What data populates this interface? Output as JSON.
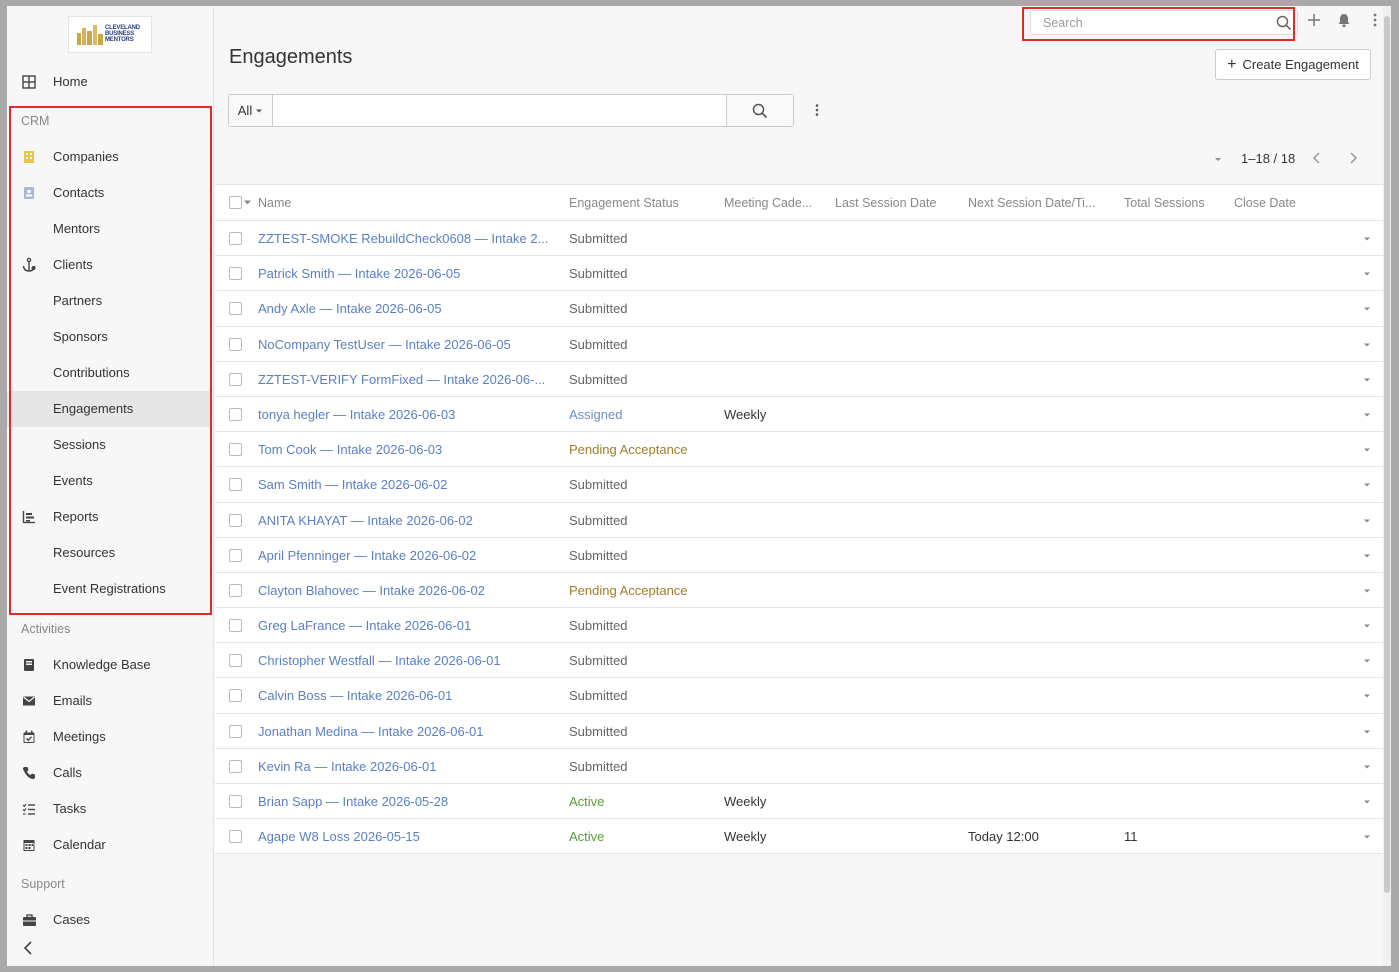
{
  "sidebar": {
    "logo_text": "CLEVELAND BUSINESS MENTORS",
    "home": "Home",
    "crm_label": "CRM",
    "crm_items": [
      {
        "label": "Companies",
        "icon": "building-icon"
      },
      {
        "label": "Contacts",
        "icon": "contact-card-icon"
      },
      {
        "label": "Mentors",
        "icon": ""
      },
      {
        "label": "Clients",
        "icon": "anchor-icon"
      },
      {
        "label": "Partners",
        "icon": ""
      },
      {
        "label": "Sponsors",
        "icon": ""
      },
      {
        "label": "Contributions",
        "icon": ""
      },
      {
        "label": "Engagements",
        "icon": "",
        "active": true
      },
      {
        "label": "Sessions",
        "icon": ""
      },
      {
        "label": "Events",
        "icon": ""
      },
      {
        "label": "Reports",
        "icon": "bar-chart-icon"
      },
      {
        "label": "Resources",
        "icon": ""
      },
      {
        "label": "Event Registrations",
        "icon": ""
      }
    ],
    "activities_label": "Activities",
    "activity_items": [
      {
        "label": "Knowledge Base",
        "icon": "book-icon"
      },
      {
        "label": "Emails",
        "icon": "envelope-icon"
      },
      {
        "label": "Meetings",
        "icon": "calendar-check-icon"
      },
      {
        "label": "Calls",
        "icon": "phone-icon"
      },
      {
        "label": "Tasks",
        "icon": "task-list-icon"
      },
      {
        "label": "Calendar",
        "icon": "calendar-icon"
      }
    ],
    "support_label": "Support",
    "support_items": [
      {
        "label": "Cases",
        "icon": "briefcase-icon"
      }
    ]
  },
  "header": {
    "title": "Engagements",
    "search_placeholder": "Search",
    "create_label": "Create Engagement"
  },
  "filter": {
    "scope": "All"
  },
  "pager": {
    "text": "1–18 / 18"
  },
  "table": {
    "columns": [
      "Name",
      "Engagement Status",
      "Meeting Cade...",
      "Last Session Date",
      "Next Session Date/Ti...",
      "Total Sessions",
      "Close Date"
    ],
    "rows": [
      {
        "name": "ZZTEST-SMOKE RebuildCheck0608 — Intake 2...",
        "status": "Submitted",
        "cadence": "",
        "next": "",
        "total": ""
      },
      {
        "name": "Patrick Smith — Intake 2026-06-05",
        "status": "Submitted",
        "cadence": "",
        "next": "",
        "total": ""
      },
      {
        "name": "Andy Axle — Intake 2026-06-05",
        "status": "Submitted",
        "cadence": "",
        "next": "",
        "total": ""
      },
      {
        "name": "NoCompany TestUser — Intake 2026-06-05",
        "status": "Submitted",
        "cadence": "",
        "next": "",
        "total": ""
      },
      {
        "name": "ZZTEST-VERIFY FormFixed — Intake 2026-06-...",
        "status": "Submitted",
        "cadence": "",
        "next": "",
        "total": ""
      },
      {
        "name": "tonya hegler — Intake 2026-06-03",
        "status": "Assigned",
        "cadence": "Weekly",
        "next": "",
        "total": ""
      },
      {
        "name": "Tom Cook — Intake 2026-06-03",
        "status": "Pending Acceptance",
        "cadence": "",
        "next": "",
        "total": ""
      },
      {
        "name": "Sam Smith — Intake 2026-06-02",
        "status": "Submitted",
        "cadence": "",
        "next": "",
        "total": ""
      },
      {
        "name": "ANITA KHAYAT — Intake 2026-06-02",
        "status": "Submitted",
        "cadence": "",
        "next": "",
        "total": ""
      },
      {
        "name": "April Pfenninger — Intake 2026-06-02",
        "status": "Submitted",
        "cadence": "",
        "next": "",
        "total": ""
      },
      {
        "name": "Clayton Blahovec — Intake 2026-06-02",
        "status": "Pending Acceptance",
        "cadence": "",
        "next": "",
        "total": ""
      },
      {
        "name": "Greg LaFrance — Intake 2026-06-01",
        "status": "Submitted",
        "cadence": "",
        "next": "",
        "total": ""
      },
      {
        "name": "Christopher Westfall — Intake 2026-06-01",
        "status": "Submitted",
        "cadence": "",
        "next": "",
        "total": ""
      },
      {
        "name": "Calvin Boss — Intake 2026-06-01",
        "status": "Submitted",
        "cadence": "",
        "next": "",
        "total": ""
      },
      {
        "name": "Jonathan Medina — Intake 2026-06-01",
        "status": "Submitted",
        "cadence": "",
        "next": "",
        "total": ""
      },
      {
        "name": "Kevin Ra — Intake 2026-06-01",
        "status": "Submitted",
        "cadence": "",
        "next": "",
        "total": ""
      },
      {
        "name": "Brian Sapp — Intake 2026-05-28",
        "status": "Active",
        "cadence": "Weekly",
        "next": "",
        "total": ""
      },
      {
        "name": "Agape W8 Loss 2026-05-15",
        "status": "Active",
        "cadence": "Weekly",
        "next": "Today 12:00",
        "total": "11"
      }
    ]
  },
  "colors": {
    "link": "#5b7fc2",
    "submitted": "#666666",
    "assigned": "#6f8fc9",
    "pending": "#a17d29",
    "active": "#5a9a38",
    "highlight": "#e02b2b"
  }
}
